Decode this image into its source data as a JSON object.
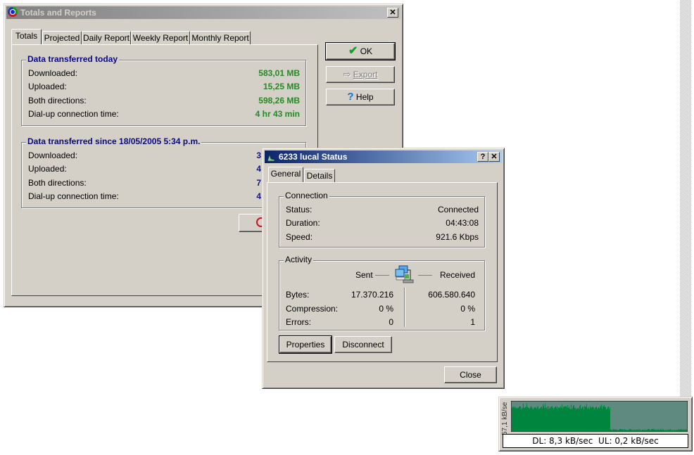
{
  "totals_window": {
    "title": "Totals and Reports",
    "close_glyph": "✕",
    "tabs": [
      "Totals",
      "Projected",
      "Daily Report",
      "Weekly Report",
      "Monthly Report"
    ],
    "selected_tab": "Totals",
    "today": {
      "heading": "Data transferred today",
      "rows": [
        {
          "label": "Downloaded:",
          "value": "583,01 MB"
        },
        {
          "label": "Uploaded:",
          "value": "15,25 MB"
        },
        {
          "label": "Both directions:",
          "value": "598,26 MB"
        },
        {
          "label": "Dial-up connection time:",
          "value": "4 hr 43 min"
        }
      ]
    },
    "since": {
      "heading": "Data transferred since 18/05/2005 5:34 p.m.",
      "rows": [
        {
          "label": "Downloaded:",
          "value": "3"
        },
        {
          "label": "Uploaded:",
          "value": "4"
        },
        {
          "label": "Both directions:",
          "value": "7"
        },
        {
          "label": "Dial-up connection time:",
          "value": "4"
        }
      ]
    },
    "buttons": {
      "ok": "OK",
      "export": "Export",
      "help": "Help"
    }
  },
  "status_window": {
    "title": "6233 lucal Status",
    "help_glyph": "?",
    "close_glyph": "✕",
    "tabs": [
      "General",
      "Details"
    ],
    "selected_tab": "General",
    "connection": {
      "heading": "Connection",
      "rows": [
        {
          "label": "Status:",
          "value": "Connected"
        },
        {
          "label": "Duration:",
          "value": "04:43:08"
        },
        {
          "label": "Speed:",
          "value": "921.6 Kbps"
        }
      ]
    },
    "activity": {
      "heading": "Activity",
      "sent_label": "Sent",
      "received_label": "Received",
      "rows": [
        {
          "label": "Bytes:",
          "sent": "17.370.216",
          "received": "606.580.640"
        },
        {
          "label": "Compression:",
          "sent": "0 %",
          "received": "0 %"
        },
        {
          "label": "Errors:",
          "sent": "0",
          "received": "1"
        }
      ]
    },
    "buttons": {
      "properties": "Properties",
      "disconnect": "Disconnect",
      "close": "Close"
    }
  },
  "meter": {
    "scale_label": "57,1 kB/se",
    "readout": "DL: 8,3 kB/sec  UL: 0,2 kB/sec",
    "download_color": "#00853f",
    "idle_color": "#5f8a80",
    "history_fraction": {
      "active_level": 0.85,
      "active_span": 0.56,
      "idle_level": 0.05
    }
  }
}
